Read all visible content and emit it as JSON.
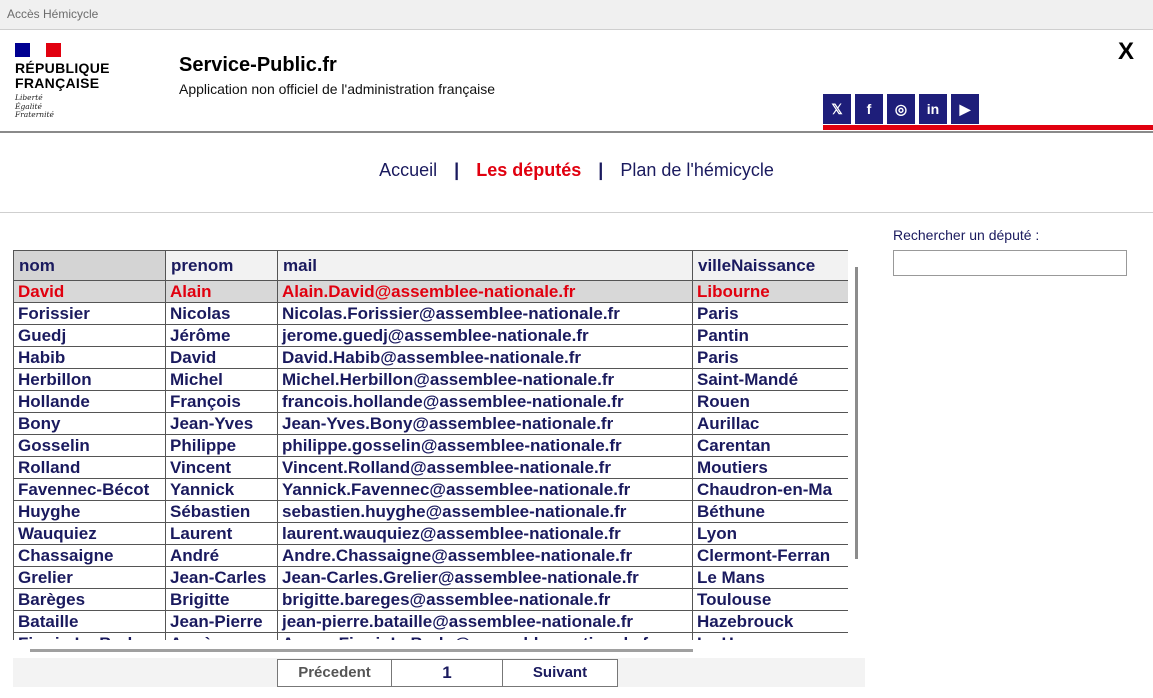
{
  "window": {
    "title": "Accès Hémicycle",
    "close_label": "X"
  },
  "logo": {
    "name": "RÉPUBLIQUE FRANÇAISE",
    "motto": [
      "Liberté",
      "Égalité",
      "Fraternité"
    ],
    "flag_colors": [
      "#000091",
      "#ffffff",
      "#e1000f"
    ]
  },
  "header": {
    "title": "Service-Public.fr",
    "subtitle": "Application non officiel de l'administration française"
  },
  "socials": [
    {
      "icon": "x-twitter-icon",
      "glyph": "𝕏"
    },
    {
      "icon": "facebook-icon",
      "glyph": "f"
    },
    {
      "icon": "instagram-icon",
      "glyph": "◎"
    },
    {
      "icon": "linkedin-icon",
      "glyph": "in"
    },
    {
      "icon": "youtube-icon",
      "glyph": "▶"
    }
  ],
  "nav": {
    "home": "Accueil",
    "deputies": "Les députés",
    "plan": "Plan de l'hémicycle",
    "separator": "|"
  },
  "search": {
    "label": "Rechercher un député :",
    "value": ""
  },
  "table": {
    "columns": [
      "nom",
      "prenom",
      "mail",
      "villeNaissance"
    ],
    "rows": [
      [
        "David",
        "Alain",
        "Alain.David@assemblee-nationale.fr",
        "Libourne"
      ],
      [
        "Forissier",
        "Nicolas",
        "Nicolas.Forissier@assemblee-nationale.fr",
        "Paris"
      ],
      [
        "Guedj",
        "Jérôme",
        "jerome.guedj@assemblee-nationale.fr",
        "Pantin"
      ],
      [
        "Habib",
        "David",
        "David.Habib@assemblee-nationale.fr",
        "Paris"
      ],
      [
        "Herbillon",
        "Michel",
        "Michel.Herbillon@assemblee-nationale.fr",
        "Saint-Mandé"
      ],
      [
        "Hollande",
        "François",
        "francois.hollande@assemblee-nationale.fr",
        "Rouen"
      ],
      [
        "Bony",
        "Jean-Yves",
        "Jean-Yves.Bony@assemblee-nationale.fr",
        "Aurillac"
      ],
      [
        "Gosselin",
        "Philippe",
        "philippe.gosselin@assemblee-nationale.fr",
        "Carentan"
      ],
      [
        "Rolland",
        "Vincent",
        "Vincent.Rolland@assemblee-nationale.fr",
        "Moutiers"
      ],
      [
        "Favennec-Bécot",
        "Yannick",
        "Yannick.Favennec@assemblee-nationale.fr",
        "Chaudron-en-Ma"
      ],
      [
        "Huyghe",
        "Sébastien",
        "sebastien.huyghe@assemblee-nationale.fr",
        "Béthune"
      ],
      [
        "Wauquiez",
        "Laurent",
        "laurent.wauquiez@assemblee-nationale.fr",
        "Lyon"
      ],
      [
        "Chassaigne",
        "André",
        "Andre.Chassaigne@assemblee-nationale.fr",
        "Clermont-Ferran"
      ],
      [
        "Grelier",
        "Jean-Carles",
        "Jean-Carles.Grelier@assemblee-nationale.fr",
        "Le Mans"
      ],
      [
        "Barèges",
        "Brigitte",
        "brigitte.bareges@assemblee-nationale.fr",
        "Toulouse"
      ],
      [
        "Bataille",
        "Jean-Pierre",
        "jean-pierre.bataille@assemblee-nationale.fr",
        "Hazebrouck"
      ],
      [
        "Firmin Le Bodo",
        "Agnès",
        "Agnes.FirminLeBodo@assemblee-nationale.fr",
        "Le Havre"
      ]
    ]
  },
  "pagination": {
    "prev": "Précedent",
    "page": "1",
    "next": "Suivant"
  }
}
